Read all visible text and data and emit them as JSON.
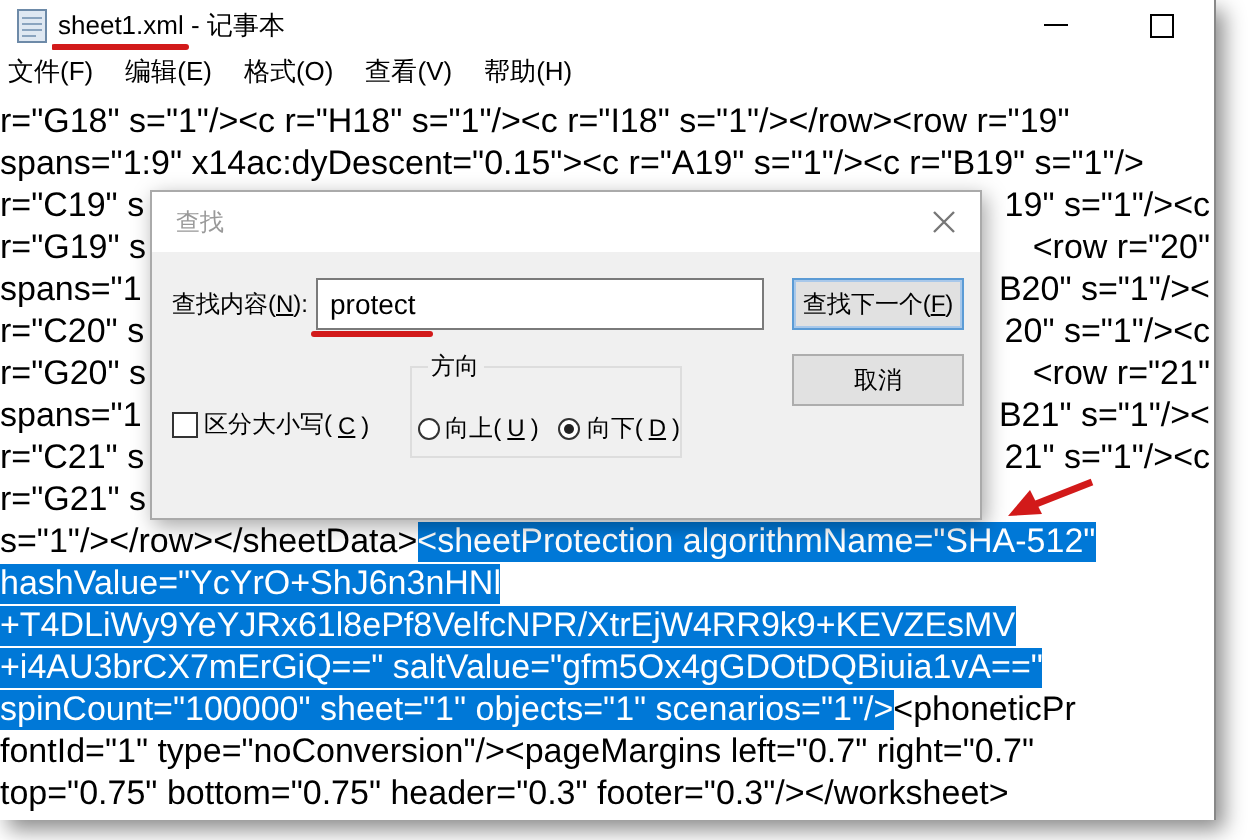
{
  "window": {
    "title": "sheet1.xml - 记事本"
  },
  "menu": [
    {
      "label": "文件(F)"
    },
    {
      "label": "编辑(E)"
    },
    {
      "label": "格式(O)"
    },
    {
      "label": "查看(V)"
    },
    {
      "label": "帮助(H)"
    }
  ],
  "editor_lines": [
    {
      "segments": [
        {
          "text": "r=\"G18\" s=\"1\"/><c r=\"H18\" s=\"1\"/><c r=\"I18\" s=\"1\"/></row><row r=\"19\"",
          "selected": false
        }
      ]
    },
    {
      "segments": [
        {
          "text": "spans=\"1:9\" x14ac:dyDescent=\"0.15\"><c r=\"A19\" s=\"1\"/><c r=\"B19\" s=\"1\"/>",
          "selected": false
        }
      ]
    },
    {
      "segments": [
        {
          "text": "r=\"C19\" s",
          "selected": false
        }
      ],
      "right_text": "19\" s=\"1\"/><c"
    },
    {
      "segments": [
        {
          "text": "r=\"G19\" s",
          "selected": false
        }
      ],
      "right_text": "<row r=\"20\""
    },
    {
      "segments": [
        {
          "text": "spans=\"1",
          "selected": false
        }
      ],
      "right_text": "B20\" s=\"1\"/><"
    },
    {
      "segments": [
        {
          "text": "r=\"C20\" s",
          "selected": false
        }
      ],
      "right_text": "20\" s=\"1\"/><c"
    },
    {
      "segments": [
        {
          "text": "r=\"G20\" s",
          "selected": false
        }
      ],
      "right_text": "<row r=\"21\""
    },
    {
      "segments": [
        {
          "text": "spans=\"1",
          "selected": false
        }
      ],
      "right_text": "B21\" s=\"1\"/><"
    },
    {
      "segments": [
        {
          "text": "r=\"C21\" s",
          "selected": false
        }
      ],
      "right_text": "21\" s=\"1\"/><c"
    },
    {
      "segments": [
        {
          "text": "r=\"G21\" s",
          "selected": false
        }
      ]
    },
    {
      "segments": [
        {
          "text": "s=\"1\"/></row></sheetData>",
          "selected": false
        },
        {
          "text": "<sheetProtection algorithmName=\"SHA-512\"",
          "selected": true
        }
      ]
    },
    {
      "segments": [
        {
          "text": "hashValue=\"YcYrO+ShJ6n3nHNl",
          "selected": true
        }
      ]
    },
    {
      "segments": [
        {
          "text": "+T4DLiWy9YeYJRx61l8ePf8VelfcNPR/XtrEjW4RR9k9+KEVZEsMV",
          "selected": true
        }
      ]
    },
    {
      "segments": [
        {
          "text": "+i4AU3brCX7mErGiQ==\" saltValue=\"gfm5Ox4gGDOtDQBiuia1vA==\"",
          "selected": true
        }
      ]
    },
    {
      "segments": [
        {
          "text": "spinCount=\"100000\" sheet=\"1\" objects=\"1\" scenarios=\"1\"/>",
          "selected": true
        },
        {
          "text": "<phoneticPr",
          "selected": false
        }
      ]
    },
    {
      "segments": [
        {
          "text": "fontId=\"1\" type=\"noConversion\"/><pageMargins left=\"0.7\" right=\"0.7\"",
          "selected": false
        }
      ]
    },
    {
      "segments": [
        {
          "text": "top=\"0.75\" bottom=\"0.75\" header=\"0.3\" footer=\"0.3\"/></worksheet>",
          "selected": false
        }
      ]
    }
  ],
  "find_dialog": {
    "title": "查找",
    "find_label": {
      "before": "查找内容(",
      "key": "N",
      "after": "):"
    },
    "find_value": "protect",
    "match_case": {
      "before": "区分大小写(",
      "key": "C",
      "after": ")",
      "checked": false
    },
    "direction": {
      "title": "方向",
      "options": [
        {
          "before": "向上(",
          "key": "U",
          "after": ")",
          "selected": false
        },
        {
          "before": "向下(",
          "key": "D",
          "after": ")",
          "selected": true
        }
      ]
    },
    "buttons": [
      {
        "before": "查找下一个(",
        "key": "F",
        "after": ")",
        "default": true
      },
      {
        "before": "取消",
        "default": false
      }
    ]
  }
}
